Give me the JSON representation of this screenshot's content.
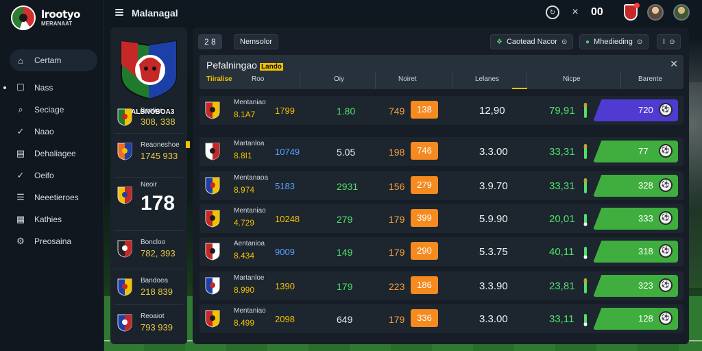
{
  "brand": {
    "name": "lrootyo",
    "sub": "MERANAAT"
  },
  "sidebar": {
    "items": [
      {
        "label": "Certam",
        "icon": "home-icon",
        "active": true
      },
      {
        "label": "Nass",
        "icon": "square-icon",
        "active": false
      },
      {
        "label": "Seciage",
        "icon": "search-icon",
        "active": false
      },
      {
        "label": "Naao",
        "icon": "check-icon",
        "active": false
      },
      {
        "label": "Dehaliagee",
        "icon": "document-icon",
        "active": false
      },
      {
        "label": "Oeifo",
        "icon": "check-icon",
        "active": false
      },
      {
        "label": "Neeetieroes",
        "icon": "list-icon",
        "active": false
      },
      {
        "label": "Kathies",
        "icon": "table-icon",
        "active": false
      },
      {
        "label": "Preosaina",
        "icon": "settings-icon",
        "active": false
      }
    ]
  },
  "topbar": {
    "title": "Malanagal",
    "score": "00",
    "close": "×"
  },
  "club": {
    "name": "ALBNOBOA3"
  },
  "side_cards": [
    {
      "name": "Beotior",
      "score": "308, 338",
      "crest": [
        "#1f7a2e",
        "#f2c200",
        "#c62828"
      ]
    },
    {
      "name": "Reaoneshoe",
      "score": "1745 933",
      "crest": [
        "#f26b1f",
        "#1c3fa8",
        "#f2c200"
      ]
    },
    {
      "name": "Neoir",
      "score": "178",
      "crest": [
        "#f2c200",
        "#c62828",
        "#1c3fa8"
      ]
    },
    {
      "name": "Boncloo",
      "score": "782, 393",
      "crest": [
        "#222222",
        "#c62828",
        "#ffffff"
      ]
    },
    {
      "name": "Bandoea",
      "score": "218 839",
      "crest": [
        "#1c3fa8",
        "#f2c200",
        "#c62828"
      ]
    },
    {
      "name": "Reoaiot",
      "score": "793 939",
      "crest": [
        "#1c3fa8",
        "#c62828",
        "#ffffff"
      ]
    }
  ],
  "chips": {
    "score": "2 8",
    "name": "Nemsolor",
    "contest": "Caotead Nacor",
    "matching": "Mhedieding",
    "page": "I"
  },
  "table": {
    "title": "Pefalningao",
    "title_badge": "Lando",
    "columns": [
      "Tiiralise",
      "Roo",
      "Oiy",
      "Noiret",
      "Lelanes",
      "Nicpe",
      "Barente"
    ],
    "active_column": 4
  },
  "rows": [
    {
      "name": "Mentaniao",
      "score": "8.1A7",
      "c1": "1799",
      "c2": "1.80",
      "c3": "749",
      "odds": "138",
      "c5": "12,90",
      "c6": "79,91",
      "trend": "up",
      "bar": "720",
      "bar_color": "purple",
      "crest": [
        "#c62828",
        "#f2c200",
        "#1c1c1c"
      ]
    },
    {
      "name": "Martanloa",
      "score": "8.8I1",
      "c1": "10749",
      "c1_blue": true,
      "c2": "5.05",
      "c2_white": true,
      "c3": "198",
      "odds": "746",
      "c5": "3.3.00",
      "c6": "33,31",
      "trend": "up",
      "bar": "77",
      "bar_color": "green",
      "crest": [
        "#ffffff",
        "#c62828",
        "#1c1c1c"
      ]
    },
    {
      "name": "Mentanaoa",
      "score": "8.974",
      "c1": "5183",
      "c1_blue": true,
      "c2": "2931",
      "c3": "156",
      "odds": "279",
      "c5": "3.9.70",
      "c6": "33,31",
      "trend": "up",
      "bar": "328",
      "bar_color": "green",
      "crest": [
        "#1c3fa8",
        "#f2c200",
        "#c62828"
      ]
    },
    {
      "name": "Mentaniao",
      "score": "4.729",
      "c1": "10248",
      "c2": "279",
      "c3": "179",
      "odds": "399",
      "c5": "5.9.90",
      "c6": "20,01",
      "trend": "down",
      "bar": "333",
      "bar_color": "green",
      "crest": [
        "#c62828",
        "#f2c200",
        "#1c1c1c"
      ]
    },
    {
      "name": "Aentanioa",
      "score": "8.434",
      "c1": "9009",
      "c1_blue": true,
      "c2": "149",
      "c3": "179",
      "odds": "290",
      "c5": "5.3.75",
      "c6": "40,11",
      "trend": "down",
      "bar": "318",
      "bar_color": "green",
      "crest": [
        "#c62828",
        "#ffffff",
        "#1c1c1c"
      ]
    },
    {
      "name": "Martanloe",
      "score": "8.990",
      "c1": "1390",
      "c2": "179",
      "c3": "223",
      "odds": "186",
      "c5": "3.3.90",
      "c6": "23,81",
      "trend": "up",
      "bar": "323",
      "bar_color": "green",
      "crest": [
        "#1c3fa8",
        "#ffffff",
        "#c62828"
      ]
    },
    {
      "name": "Mentaniao",
      "score": "8.499",
      "c1": "2098",
      "c2": "649",
      "c2_white": true,
      "c3": "179",
      "odds": "336",
      "c5": "3.3.00",
      "c6": "33,11",
      "trend": "down",
      "bar": "128",
      "bar_color": "green",
      "crest": [
        "#c62828",
        "#f2c200",
        "#1c1c1c"
      ]
    }
  ],
  "colors": {
    "accent": "#f2c200",
    "odds": "#f58a1f",
    "positive": "#4ee06a",
    "bar_green": "#3fae3f",
    "bar_purple": "#4f3bd1"
  }
}
